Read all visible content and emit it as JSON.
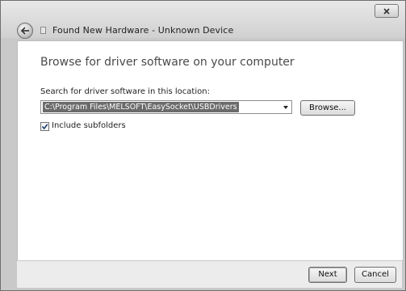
{
  "window": {
    "title": "Found New Hardware - Unknown Device",
    "close_icon": "close-icon",
    "back_icon": "back-arrow-icon",
    "hardware_icon": "hardware-device-icon"
  },
  "page": {
    "heading": "Browse for driver software on your computer",
    "search_label": "Search for driver software in this location:",
    "path_value": "C:\\Program Files\\MELSOFT\\EasySocket\\USBDrivers",
    "browse_label": "Browse...",
    "include_subfolders_label": "Include subfolders",
    "include_subfolders_checked": true
  },
  "footer": {
    "next_label": "Next",
    "cancel_label": "Cancel"
  }
}
